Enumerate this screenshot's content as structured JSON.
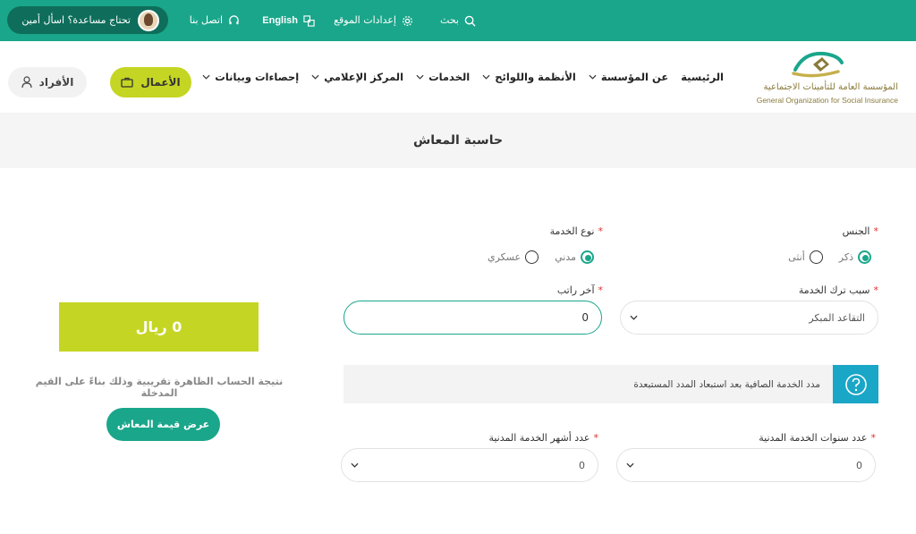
{
  "topbar": {
    "search": "بحث",
    "site_settings": "إعدادات الموقع",
    "language": "English",
    "contact": "اتصل بنا",
    "help": "تحتاج مساعدة؟ اسأل أمين"
  },
  "header": {
    "logo_ar": "المؤسسة العامة للتأمينات الاجتماعية",
    "logo_en": "General Organization for Social Insurance",
    "nav": {
      "home": "الرئيسية",
      "about": "عن المؤسسة",
      "regulations": "الأنظمة واللوائح",
      "services": "الخدمات",
      "media": "المركز الإعلامي",
      "stats": "إحصاءات وبيانات"
    },
    "business_label": "الأعمال",
    "individuals_label": "الأفراد"
  },
  "page": {
    "title": "حاسبة المعاش"
  },
  "form": {
    "gender": {
      "label": "الجنس",
      "options": {
        "male": "ذكر",
        "female": "أنثى"
      },
      "selected": "ذكر"
    },
    "service_type": {
      "label": "نوع الخدمة",
      "options": {
        "civil": "مدني",
        "military": "عسكري"
      },
      "selected": "مدني"
    },
    "leave_reason": {
      "label": "سبب ترك الخدمة",
      "value": "التقاعد المبكر"
    },
    "last_salary": {
      "label": "آخر راتب",
      "value": "0"
    },
    "info_text": "مدد الخدمة الصافية بعد استبعاد المدد المستبعدة",
    "civil_years": {
      "label": "عدد سنوات الخدمة المدنية",
      "value": "0"
    },
    "civil_months": {
      "label": "عدد أشهر الخدمة المدنية",
      "value": "0"
    }
  },
  "result": {
    "amount": "0 ريال",
    "note": "نتيجة الحساب الظاهرة تقريبية وذلك بناءً على القيم المدخلة",
    "button": "عرض قيمة المعاش"
  },
  "colors": {
    "primary": "#1aa68a",
    "accent": "#c5d523",
    "info": "#1aa6c6"
  }
}
